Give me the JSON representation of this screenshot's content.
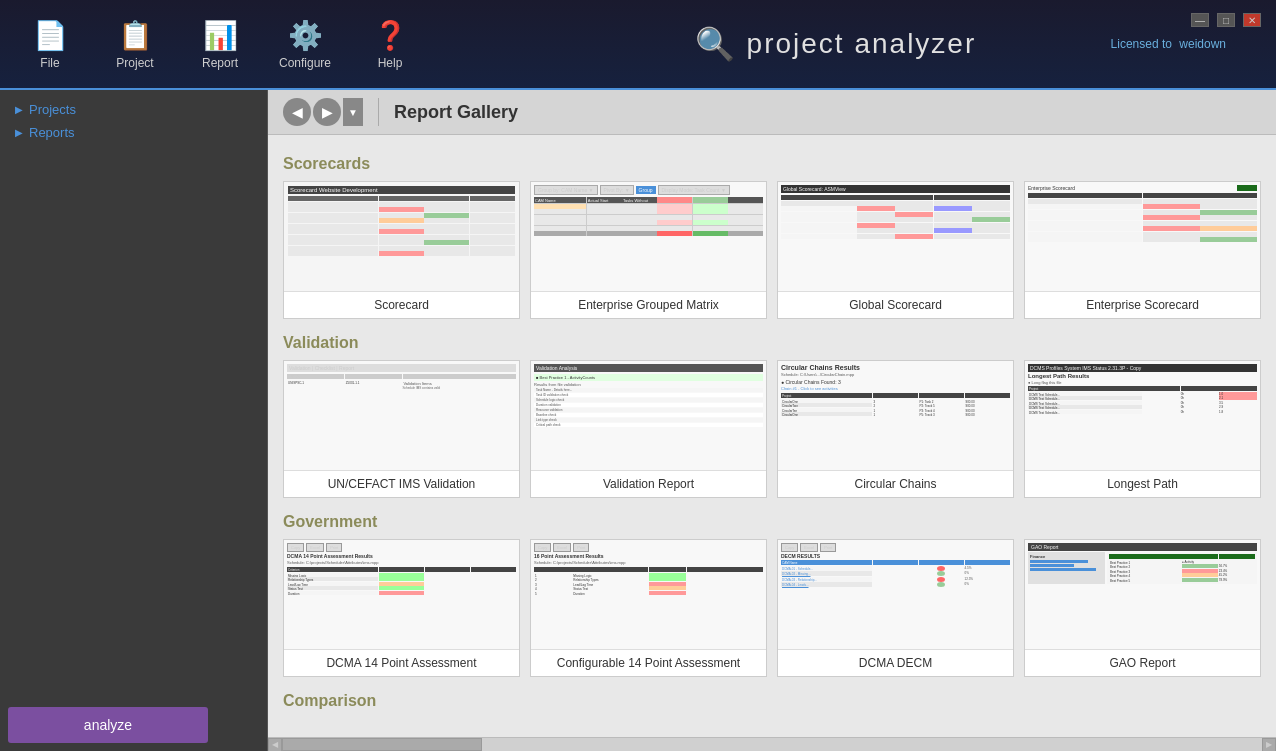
{
  "app": {
    "title": "project analyzer",
    "license_label": "Licensed to",
    "license_user": "weidown"
  },
  "toolbar": {
    "buttons": [
      {
        "id": "file",
        "label": "File",
        "icon": "📄"
      },
      {
        "id": "project",
        "label": "Project",
        "icon": "📋"
      },
      {
        "id": "report",
        "label": "Report",
        "icon": "📊"
      },
      {
        "id": "configure",
        "label": "Configure",
        "icon": "⚙️"
      },
      {
        "id": "help",
        "label": "Help",
        "icon": "❓"
      }
    ]
  },
  "window_controls": {
    "minimize": "—",
    "maximize": "□",
    "close": "✕"
  },
  "sidebar": {
    "items": [
      {
        "label": "Projects"
      },
      {
        "label": "Reports"
      }
    ]
  },
  "gallery": {
    "title": "Report Gallery",
    "sections": [
      {
        "id": "scorecards",
        "label": "Scorecards",
        "reports": [
          {
            "id": "scorecard",
            "label": "Scorecard"
          },
          {
            "id": "enterprise-grouped-matrix",
            "label": "Enterprise Grouped Matrix"
          },
          {
            "id": "global-scorecard",
            "label": "Global Scorecard"
          },
          {
            "id": "enterprise-scorecard",
            "label": "Enterprise Scorecard"
          }
        ]
      },
      {
        "id": "validation",
        "label": "Validation",
        "reports": [
          {
            "id": "un-cefact-ims",
            "label": "UN/CEFACT IMS Validation"
          },
          {
            "id": "validation-report",
            "label": "Validation Report"
          },
          {
            "id": "circular-chains",
            "label": "Circular Chains"
          },
          {
            "id": "longest-path",
            "label": "Longest Path"
          }
        ]
      },
      {
        "id": "government",
        "label": "Government",
        "reports": [
          {
            "id": "dcma-14-point",
            "label": "DCMA 14 Point Assessment"
          },
          {
            "id": "configurable-14-point",
            "label": "Configurable 14 Point Assessment"
          },
          {
            "id": "dcma-decm",
            "label": "DCMA DECM"
          },
          {
            "id": "gao-report",
            "label": "GAO Report"
          }
        ]
      },
      {
        "id": "comparison",
        "label": "Comparison",
        "reports": []
      }
    ]
  },
  "analyze_btn_label": "analyze",
  "colors": {
    "accent": "#4a90d9",
    "brand_purple": "#7b4fa0",
    "header_gold": "#8b8b5a",
    "sidebar_bg": "#3a3a3a",
    "titlebar": "#1a1a2e"
  }
}
